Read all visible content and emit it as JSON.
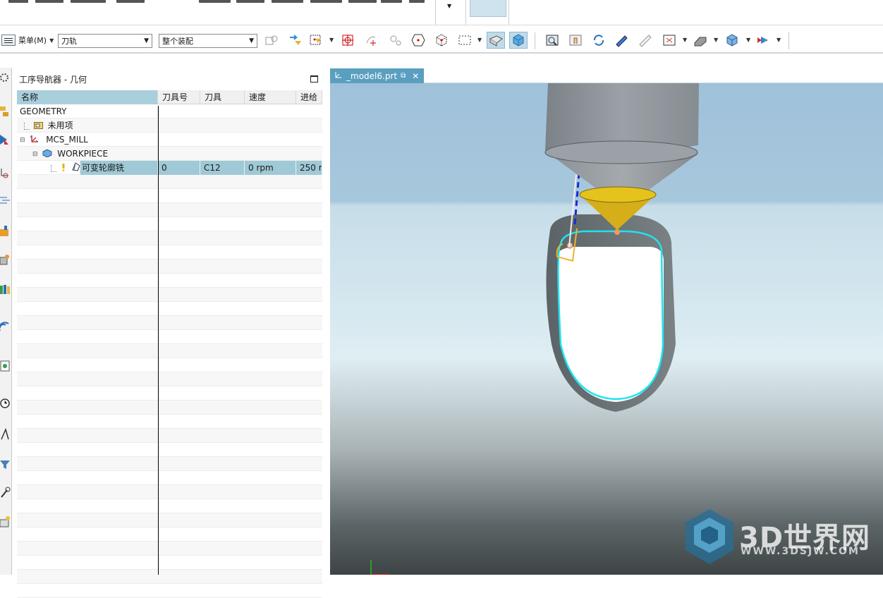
{
  "toolbar": {
    "menu_label": "菜单(M)",
    "type_filter": "刀轨",
    "selection_scope": "整个装配"
  },
  "navigator": {
    "title": "工序导航器 - 几何",
    "columns": [
      "名称",
      "刀具号",
      "刀具",
      "速度",
      "进给"
    ],
    "rows": [
      {
        "name": "GEOMETRY",
        "tool_no": "",
        "tool": "",
        "speed": "",
        "feed": ""
      },
      {
        "name": "未用项",
        "tool_no": "",
        "tool": "",
        "speed": "",
        "feed": ""
      },
      {
        "name": "MCS_MILL",
        "tool_no": "",
        "tool": "",
        "speed": "",
        "feed": ""
      },
      {
        "name": "WORKPIECE",
        "tool_no": "",
        "tool": "",
        "speed": "",
        "feed": ""
      },
      {
        "name": "可变轮廓铣",
        "tool_no": "0",
        "tool": "C12",
        "speed": "0 rpm",
        "feed": "250 r"
      }
    ]
  },
  "graphics": {
    "tab_label": "_model6.prt"
  },
  "watermark": {
    "brand": "3D世界网",
    "url": "WWW.3DSJW.COM"
  },
  "colors": {
    "accent": "#5a9fc0",
    "selection": "#9fc9d6",
    "toolpath": "#1fe3f0"
  }
}
